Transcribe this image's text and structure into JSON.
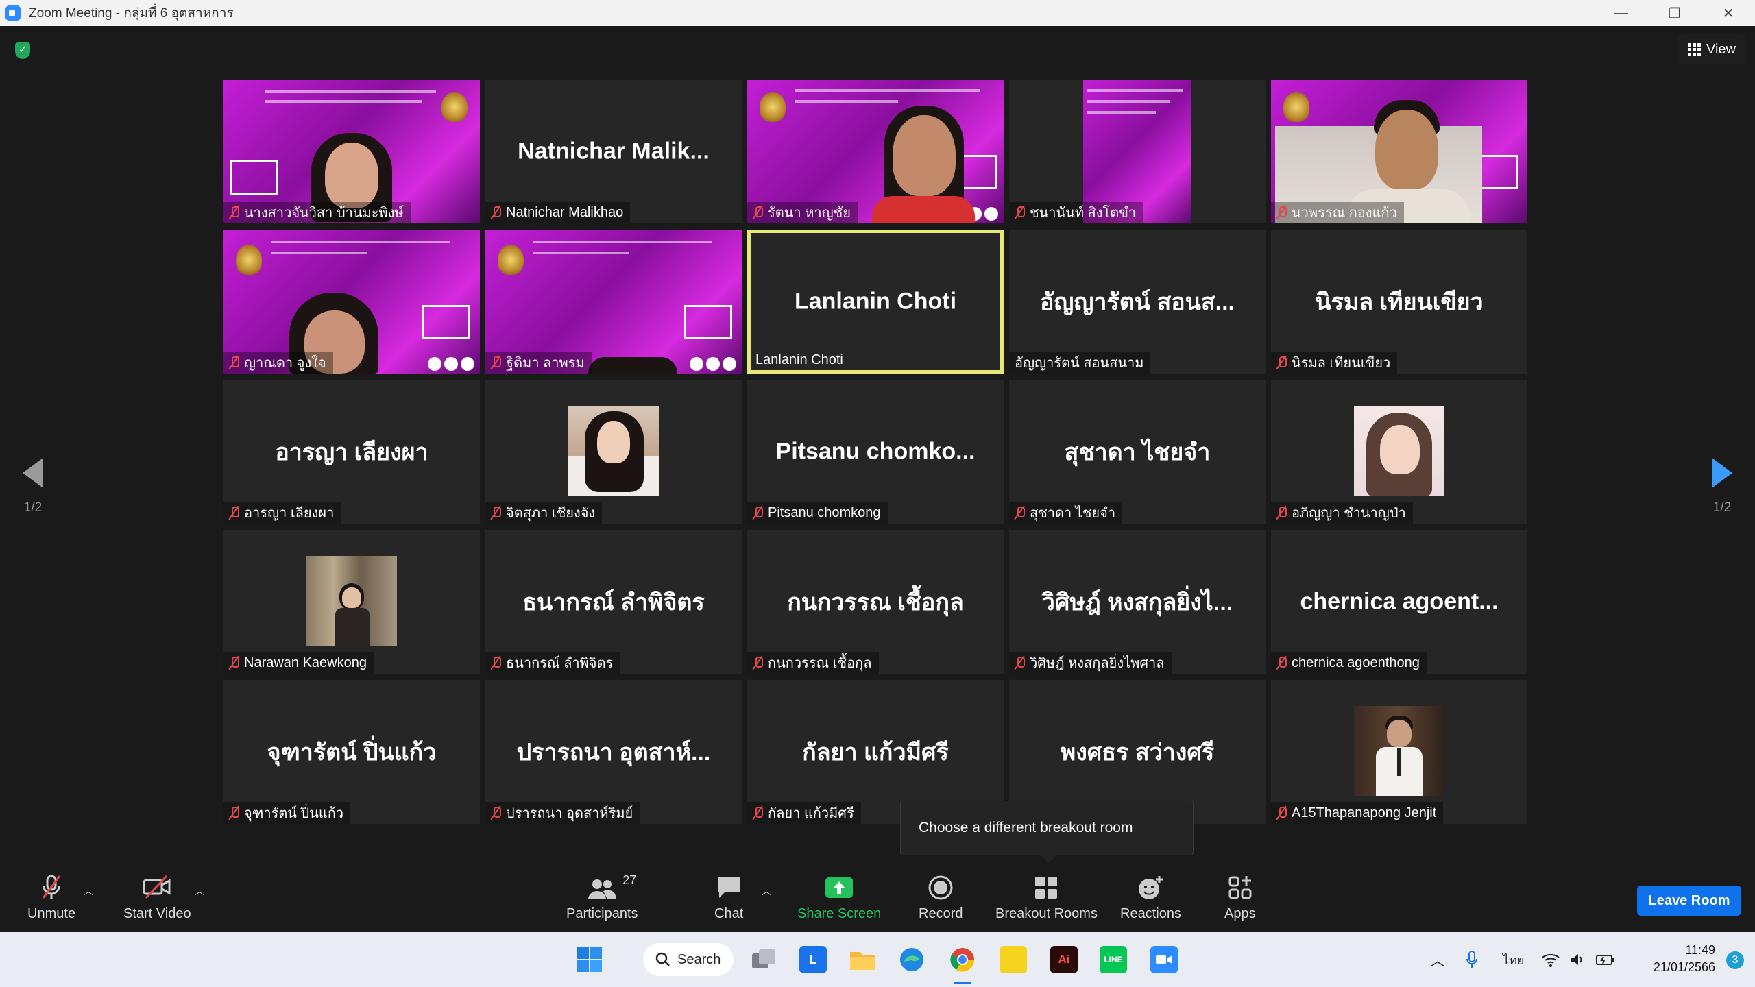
{
  "window": {
    "title": "Zoom Meeting - กลุ่มที่ 6 อุตสาหการ",
    "minimize": "—",
    "restore": "❐",
    "close": "✕"
  },
  "meeting": {
    "view_label": "View",
    "page_indicator": "1/2"
  },
  "tiles": [
    {
      "name": "นางสาวจันวิสา บ้านมะพิงษ์",
      "type": "video"
    },
    {
      "name": "Natnichar Malikhao",
      "display": "Natnichar  Malik...",
      "type": "name"
    },
    {
      "name": "รัตนา หาญชัย",
      "type": "video"
    },
    {
      "name": "ชนานันท์ สิงโตขำ",
      "type": "video"
    },
    {
      "name": "นวพรรณ กองแก้ว",
      "type": "video"
    },
    {
      "name": "ญาณดา จูงใจ",
      "type": "video"
    },
    {
      "name": "ฐิติมา ลาพรม",
      "type": "video"
    },
    {
      "name": "Lanlanin Choti",
      "display": "Lanlanin Choti",
      "type": "name",
      "active": true
    },
    {
      "name": "อัญญารัตน์ สอนสนาม",
      "display": "อัญญารัตน์ สอนส...",
      "type": "name"
    },
    {
      "name": "นิรมล เทียนเขียว",
      "display": "นิรมล เทียนเขียว",
      "type": "name"
    },
    {
      "name": "อารญา เลียงผา",
      "display": "อารญา เลียงผา",
      "type": "name"
    },
    {
      "name": "จิตสุภา เชียงจัง",
      "type": "photo"
    },
    {
      "name": "Pitsanu chomkong",
      "display": "Pitsanu  chomko...",
      "type": "name"
    },
    {
      "name": "สุชาดา ไชยจำ",
      "display": "สุชาดา ไชยจำ",
      "type": "name"
    },
    {
      "name": "อภิญญา ชำนาญป่า",
      "type": "photo"
    },
    {
      "name": "Narawan Kaewkong",
      "type": "photo"
    },
    {
      "name": "ธนากรณ์ ลำพิจิตร",
      "display": "ธนากรณ์ ลำพิจิตร",
      "type": "name"
    },
    {
      "name": "กนกวรรณ เชื้อกุล",
      "display": "กนกวรรณ เชื้อกุล",
      "type": "name"
    },
    {
      "name": "วิศิษฎ์ หงสกุลยิ่งไพศาล",
      "display": "วิศิษฎ์ หงสกุลยิ่งไ...",
      "type": "name"
    },
    {
      "name": "chernica agoenthong",
      "display": "chernica  agoent...",
      "type": "name"
    },
    {
      "name": "จุฑารัตน์ ปิ่นแก้ว",
      "display": "จุฑารัตน์ ปิ่นแก้ว",
      "type": "name"
    },
    {
      "name": "ปรารถนา อุดสาห์ริมย์",
      "display": "ปรารถนา อุตสาห์...",
      "type": "name"
    },
    {
      "name": "กัลยา แก้วมีศรี",
      "display": "กัลยา แก้วมีศรี",
      "type": "name"
    },
    {
      "name": "พงศธร สว่างศรี",
      "display": "พงศธร สว่างศรี",
      "type": "name"
    },
    {
      "name": "A15Thapanapong Jenjit",
      "type": "photo"
    }
  ],
  "tooltip": "Choose a different breakout room",
  "toolbar": {
    "unmute": "Unmute",
    "start_video": "Start Video",
    "participants": "Participants",
    "participants_count": "27",
    "chat": "Chat",
    "share_screen": "Share Screen",
    "record": "Record",
    "breakout_rooms": "Breakout Rooms",
    "reactions": "Reactions",
    "apps": "Apps",
    "leave_room": "Leave Room"
  },
  "taskbar": {
    "search": "Search",
    "language": "ไทย",
    "time": "11:49",
    "date": "21/01/2566",
    "notifications": "3"
  },
  "colors": {
    "accent_blue": "#0e72ed",
    "muted_red": "#e2474d",
    "active_speaker": "#e6e97a",
    "share_green": "#23c35a"
  }
}
